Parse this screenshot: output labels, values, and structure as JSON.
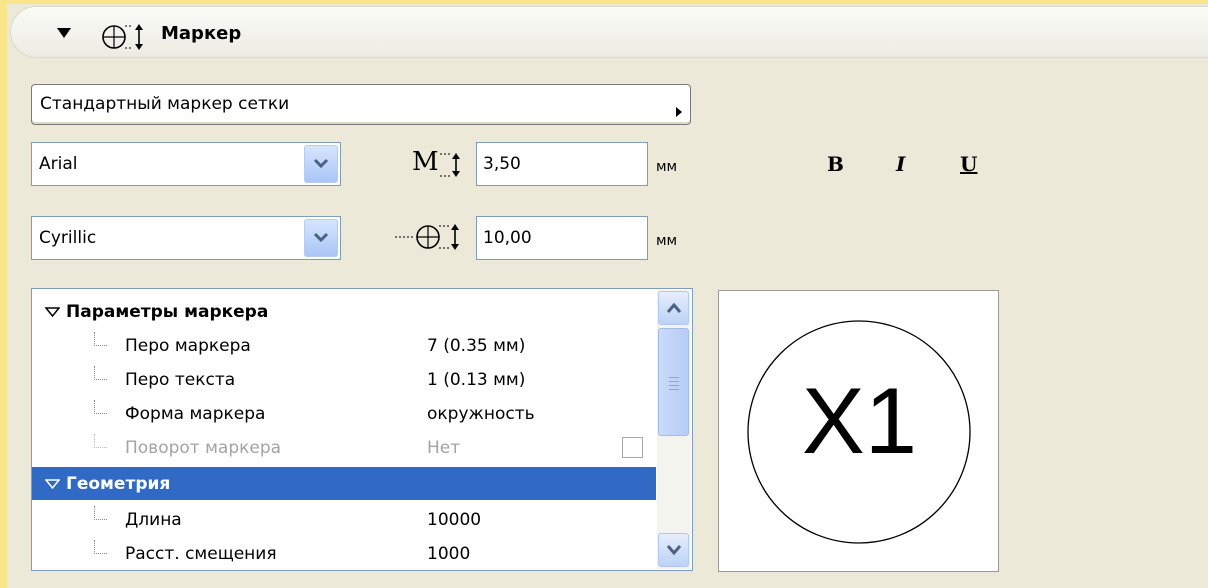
{
  "header": {
    "title": "Маркер",
    "arrow_icon": "collapse-triangle-icon",
    "icon": "marker-height-icon"
  },
  "style_select": {
    "value": "Стандартный маркер сетки"
  },
  "font": {
    "family": "Arial",
    "script": "Cyrillic",
    "size_label": "M",
    "size_value": "3,50",
    "size_unit": "мм",
    "marker_size_value": "10,00",
    "marker_size_unit": "мм"
  },
  "format": {
    "bold": "B",
    "italic": "I",
    "underline": "U"
  },
  "tree": {
    "groups": [
      {
        "label": "Параметры маркера",
        "items": [
          {
            "label": "Перо маркера",
            "value": "7 (0.35 мм)"
          },
          {
            "label": "Перо текста",
            "value": "1 (0.13 мм)"
          },
          {
            "label": "Форма маркера",
            "value": "окружность"
          },
          {
            "label": "Поворот маркера",
            "value": "Нет",
            "disabled": true
          }
        ]
      },
      {
        "label": "Геометрия",
        "selected": true,
        "items": [
          {
            "label": "Длина",
            "value": "10000"
          },
          {
            "label": "Расст. смещения",
            "value": "1000"
          }
        ]
      }
    ]
  },
  "preview": {
    "text": "X1"
  },
  "colors": {
    "background": "#fbe58a",
    "panel": "#ece9d8",
    "selection": "#316ac5"
  }
}
